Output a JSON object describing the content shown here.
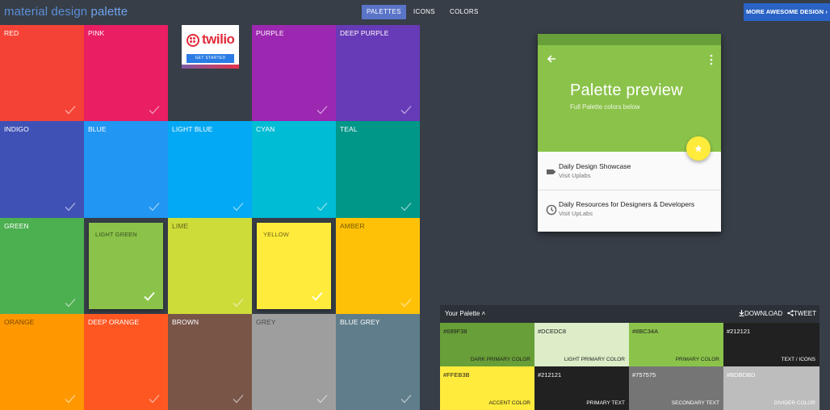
{
  "header": {
    "brand_part1": "material design",
    "brand_part2": "palette",
    "nav": [
      "PALETTES",
      "ICONS",
      "COLORS"
    ],
    "more_button": "MORE AWESOME DESIGN"
  },
  "ad": {
    "logo": "twilio",
    "cta": "GET STARTED"
  },
  "palettes": [
    {
      "name": "RED",
      "color": "#f44336",
      "dark_label": false
    },
    {
      "name": "PINK",
      "color": "#e91e63",
      "dark_label": false
    },
    {
      "name": "",
      "color": "#373e47",
      "dark_label": false
    },
    {
      "name": "PURPLE",
      "color": "#9c27b0",
      "dark_label": false
    },
    {
      "name": "DEEP PURPLE",
      "color": "#673ab7",
      "dark_label": false
    },
    {
      "name": "INDIGO",
      "color": "#3f51b5",
      "dark_label": false
    },
    {
      "name": "BLUE",
      "color": "#2196f3",
      "dark_label": false
    },
    {
      "name": "LIGHT BLUE",
      "color": "#03a9f4",
      "dark_label": false
    },
    {
      "name": "CYAN",
      "color": "#00bcd4",
      "dark_label": false
    },
    {
      "name": "TEAL",
      "color": "#009688",
      "dark_label": false
    },
    {
      "name": "GREEN",
      "color": "#4caf50",
      "dark_label": false
    },
    {
      "name": "LIGHT GREEN",
      "color": "#8bc34a",
      "dark_label": true,
      "selected": true
    },
    {
      "name": "LIME",
      "color": "#cddc39",
      "dark_label": true
    },
    {
      "name": "YELLOW",
      "color": "#ffeb3b",
      "dark_label": true,
      "selected": true
    },
    {
      "name": "AMBER",
      "color": "#ffc107",
      "dark_label": true
    },
    {
      "name": "ORANGE",
      "color": "#ff9800",
      "dark_label": true
    },
    {
      "name": "DEEP ORANGE",
      "color": "#ff5722",
      "dark_label": false
    },
    {
      "name": "BROWN",
      "color": "#795548",
      "dark_label": false
    },
    {
      "name": "GREY",
      "color": "#9e9e9e",
      "dark_label": true
    },
    {
      "name": "BLUE GREY",
      "color": "#607d8b",
      "dark_label": false
    }
  ],
  "preview": {
    "title": "Palette preview",
    "subtitle": "Full Palette colors below",
    "items": [
      {
        "title": "Daily Design Showcase",
        "subtitle": "Visit Uplabs",
        "icon": "label-icon"
      },
      {
        "title": "Daily Resources for Designers & Developers",
        "subtitle": "Visit UpLabs",
        "icon": "clock-icon"
      }
    ]
  },
  "your_palette": {
    "title": "Your Palette",
    "download": "DOWNLOAD",
    "tweet": "TWEET",
    "swatches": [
      {
        "hex": "#689F38",
        "role": "DARK PRIMARY COLOR",
        "bg": "#689f38",
        "fg": "#212121"
      },
      {
        "hex": "#DCEDC8",
        "role": "LIGHT PRIMARY COLOR",
        "bg": "#dcedc8",
        "fg": "#212121"
      },
      {
        "hex": "#8BC34A",
        "role": "PRIMARY COLOR",
        "bg": "#8bc34a",
        "fg": "#212121"
      },
      {
        "hex": "#212121",
        "role": "TEXT / ICONS",
        "bg": "#212121",
        "fg": "#ffffff"
      },
      {
        "hex": "#FFEB3B",
        "role": "ACCENT COLOR",
        "bg": "#ffeb3b",
        "fg": "#212121"
      },
      {
        "hex": "#212121",
        "role": "PRIMARY TEXT",
        "bg": "#212121",
        "fg": "#ffffff"
      },
      {
        "hex": "#757575",
        "role": "SECONDARY TEXT",
        "bg": "#757575",
        "fg": "#ffffff"
      },
      {
        "hex": "#BDBDBD",
        "role": "DIVIDER COLOR",
        "bg": "#bdbdbd",
        "fg": "#ffffff"
      }
    ]
  }
}
